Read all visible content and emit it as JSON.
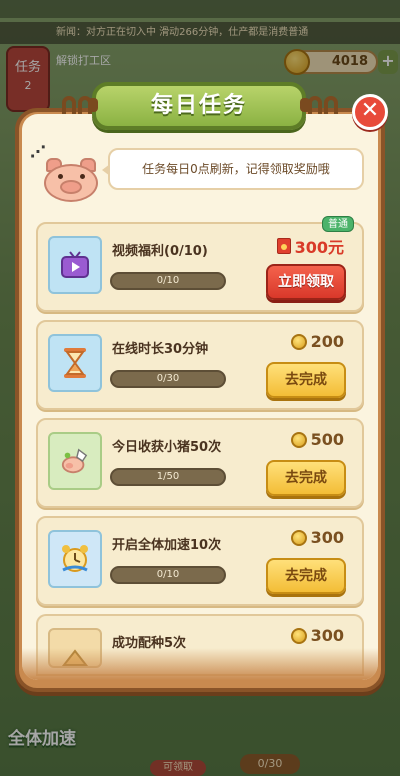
{
  "scene": {
    "ticker_text": "新闻：对方正在切入中 滑动266分钟，仕产都是消费普通",
    "task_tab": {
      "label": "任务",
      "count": "2"
    },
    "zone_label": "解锁打工区",
    "coins": "4018",
    "plus_label": "+",
    "accelerate_label": "全体加速",
    "bottom_pill_label": "0/30",
    "bottom_pill2_label": "可领取"
  },
  "modal": {
    "title": "每日任务",
    "close_label": "✕",
    "notice": "任务每日0点刷新，记得领取奖励哦",
    "tasks": [
      {
        "name": "视频福利(0/10)",
        "progress": "0/10",
        "reward": "300元",
        "reward_type": "cash",
        "button": "立即领取",
        "button_style": "claim",
        "tag": "普通"
      },
      {
        "name": "在线时长30分钟",
        "progress": "0/30",
        "reward": "200",
        "reward_type": "coin",
        "button": "去完成",
        "button_style": "go"
      },
      {
        "name": "今日收获小猪50次",
        "progress": "1/50",
        "reward": "500",
        "reward_type": "coin",
        "button": "去完成",
        "button_style": "go"
      },
      {
        "name": "开启全体加速10次",
        "progress": "0/10",
        "reward": "300",
        "reward_type": "coin",
        "button": "去完成",
        "button_style": "go"
      },
      {
        "name": "成功配种5次",
        "progress": "",
        "reward": "300",
        "reward_type": "coin",
        "button": "",
        "button_style": "go"
      }
    ]
  },
  "colors": {
    "accent_green": "#8bb243",
    "claim_red": "#d9382a",
    "go_yellow": "#f3bd36",
    "panel_brown": "#c98a4f"
  }
}
